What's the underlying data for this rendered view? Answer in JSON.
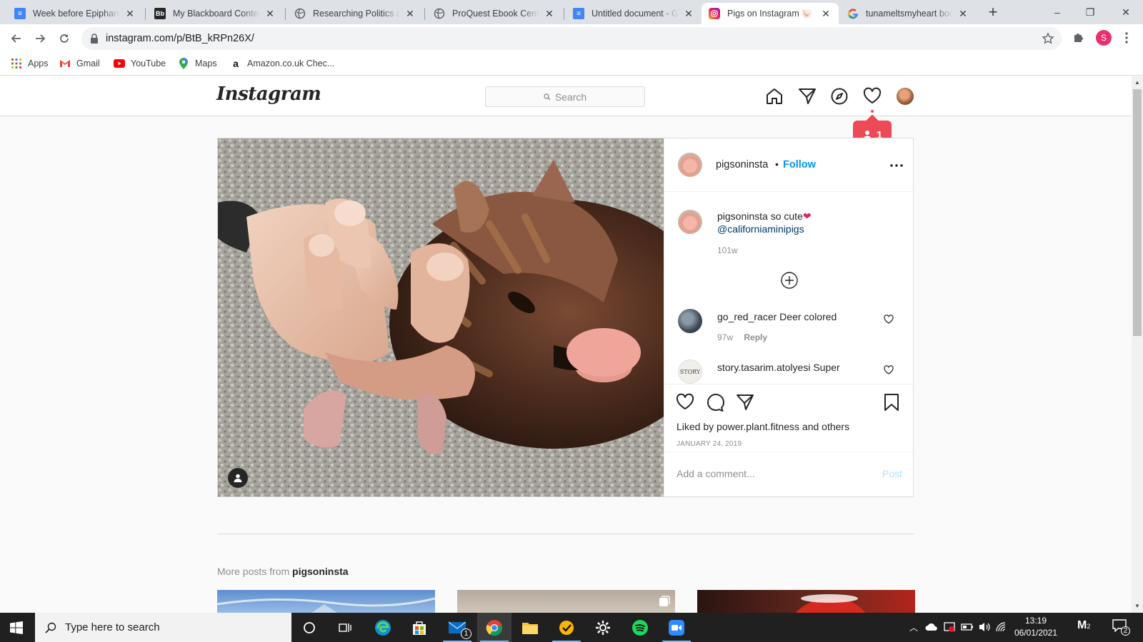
{
  "browser": {
    "tabs": [
      {
        "title": "Week before Epiphany",
        "icon": "google-docs-icon",
        "active": false
      },
      {
        "title": "My Blackboard Content",
        "icon": "blackboard-icon",
        "active": false
      },
      {
        "title": "Researching Politics and",
        "icon": "globe-icon",
        "active": false
      },
      {
        "title": "ProQuest Ebook Central",
        "icon": "globe-icon",
        "active": false
      },
      {
        "title": "Untitled document - Google",
        "icon": "google-docs-icon",
        "active": false
      },
      {
        "title": "Pigs on Instagram 🐷 on",
        "icon": "instagram-icon",
        "active": true
      },
      {
        "title": "tunameltsmyheart book",
        "icon": "google-icon",
        "active": false
      }
    ],
    "new_tab": "+",
    "window_controls": {
      "minimize": "–",
      "restore": "❐",
      "close": "✕"
    },
    "url": "instagram.com/p/BtB_kRPn26X/",
    "profile_initial": "S",
    "bookmarks": [
      {
        "label": "Apps",
        "icon": "apps-grid-icon"
      },
      {
        "label": "Gmail",
        "icon": "gmail-icon"
      },
      {
        "label": "YouTube",
        "icon": "youtube-icon"
      },
      {
        "label": "Maps",
        "icon": "maps-pin-icon"
      },
      {
        "label": "Amazon.co.uk Chec...",
        "icon": "amazon-icon"
      }
    ]
  },
  "instagram": {
    "logo": "Instagram",
    "search_placeholder": "Search",
    "activity_count": "1",
    "post": {
      "username": "pigsoninsta",
      "follow_label": "Follow",
      "separator": "•",
      "caption_username": "pigsoninsta",
      "caption_text": "so cute",
      "caption_emoji": "❤",
      "caption_mention": "@californiaminipigs",
      "caption_age": "101w",
      "comments": [
        {
          "username": "go_red_racer",
          "text": "Deer colored",
          "age": "97w",
          "reply": "Reply"
        },
        {
          "username": "story.tasarim.atolyesi",
          "text": "Super",
          "avatar_text": "STORY"
        }
      ],
      "liked_prefix": "Liked by",
      "liked_user": "power.plant.fitness",
      "liked_and": "and",
      "liked_others": "others",
      "date": "JANUARY 24, 2019",
      "add_comment_placeholder": "Add a comment...",
      "post_button": "Post"
    },
    "more_posts_prefix": "More posts from",
    "more_posts_user": "pigsoninsta"
  },
  "taskbar": {
    "search_placeholder": "Type here to search",
    "mail_badge": "1",
    "time": "13:19",
    "date": "06/01/2021",
    "notifications": "2",
    "ime_badge": "2"
  },
  "colors": {
    "instagram_blue": "#0095f6",
    "activity_red": "#ed4956",
    "chrome_tabstrip": "#dee1e6"
  }
}
